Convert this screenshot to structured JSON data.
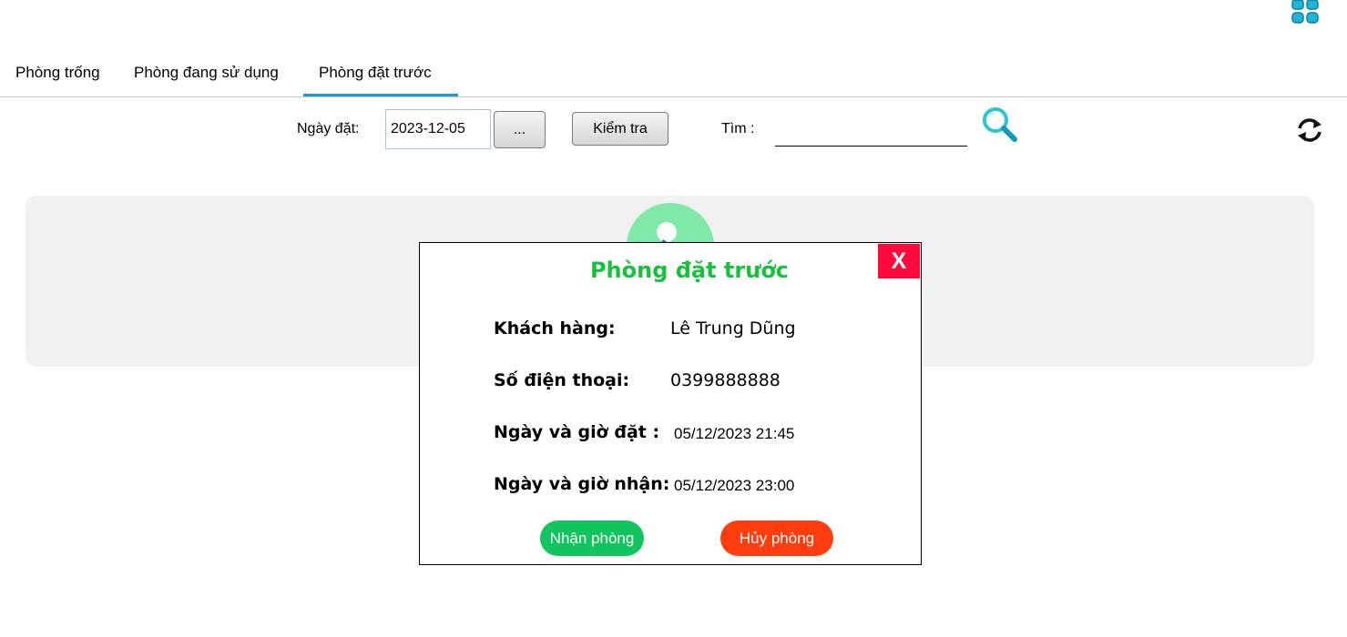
{
  "header": {
    "apps_icon": "apps-grid-icon",
    "accent_color": "#1aa3c9"
  },
  "tabs": [
    {
      "label": "Phòng trống",
      "active": false
    },
    {
      "label": "Phòng đang sử dụng",
      "active": false
    },
    {
      "label": "Phòng đặt trước",
      "active": true
    }
  ],
  "toolbar": {
    "date_label": "Ngày đặt:",
    "date_value": "2023-12-05",
    "picker_label": "...",
    "check_label": "Kiểm tra",
    "search_label": "Tìm :",
    "search_value": "",
    "search_icon": "search-icon",
    "refresh_icon": "refresh-icon"
  },
  "dialog": {
    "title": "Phòng đặt trước",
    "close_label": "X",
    "fields": [
      {
        "label": "Khách hàng:",
        "value": "Lê Trung Dũng"
      },
      {
        "label": "Số điện thoại:",
        "value": "0399888888"
      },
      {
        "label": "Ngày và giờ đặt :",
        "value": "05/12/2023 21:45"
      },
      {
        "label": "Ngày và giờ nhận:",
        "value": "05/12/2023 23:00"
      }
    ],
    "accept_label": "Nhận phòng",
    "cancel_label": "Hủy phòng",
    "colors": {
      "title": "#17c13e",
      "close": "#ff0a3c",
      "accept": "#12c45e",
      "cancel": "#ff3d0f"
    }
  }
}
